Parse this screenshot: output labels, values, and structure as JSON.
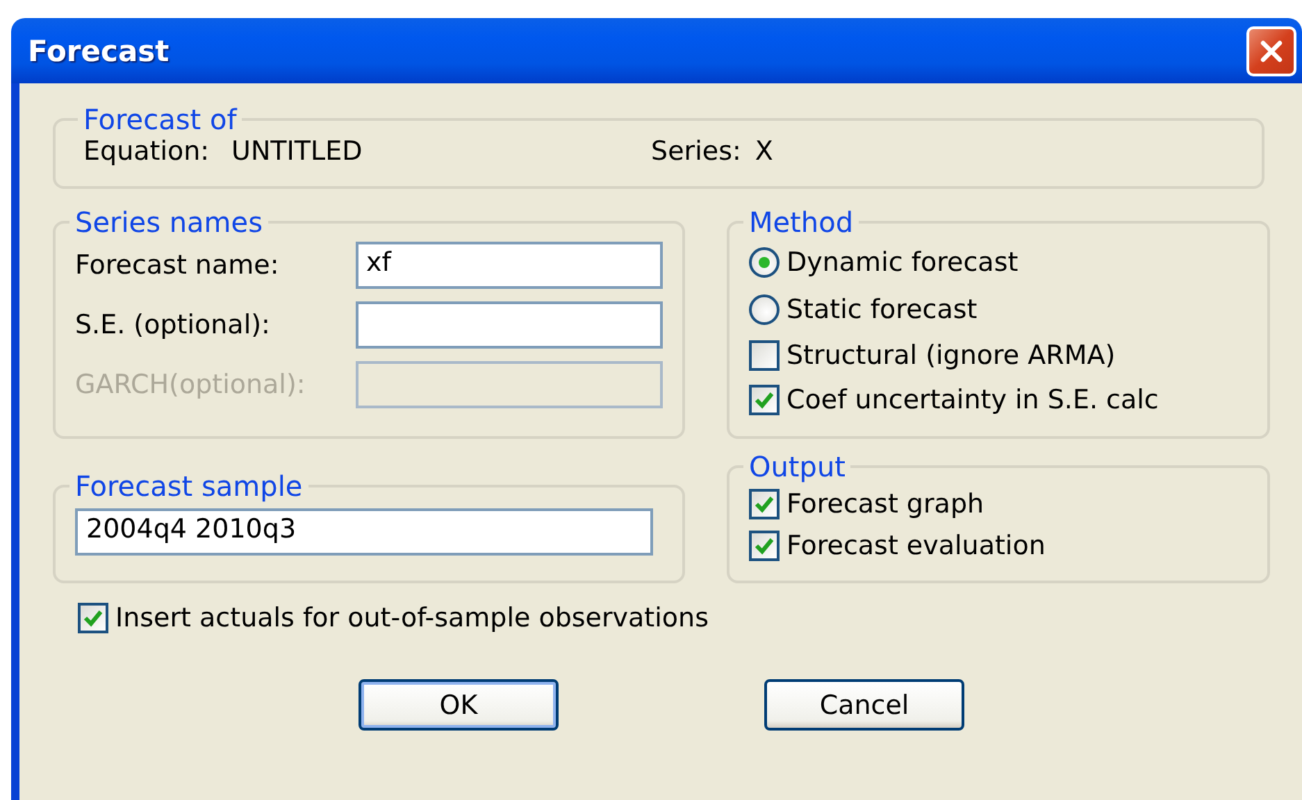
{
  "window": {
    "title": "Forecast"
  },
  "forecast_of": {
    "title": "Forecast of",
    "equation_label": "Equation:",
    "equation": "UNTITLED",
    "series_label": "Series:",
    "series": "X"
  },
  "series_names": {
    "title": "Series names",
    "fields": [
      {
        "label": "Forecast name:",
        "value": "xf",
        "disabled": false
      },
      {
        "label": "S.E. (optional):",
        "disabled": false
      },
      {
        "label": "GARCH(optional):",
        "disabled": true
      }
    ]
  },
  "method": {
    "title": "Method",
    "options": [
      {
        "kind": "radio",
        "label": "Dynamic forecast",
        "selected": true
      },
      {
        "kind": "radio",
        "label": "Static forecast",
        "selected": false
      },
      {
        "kind": "checkbox",
        "label": "Structural (ignore ARMA)",
        "checked": false
      },
      {
        "kind": "checkbox",
        "label": "Coef uncertainty in S.E. calc",
        "checked": true
      }
    ]
  },
  "forecast_sample": {
    "title": "Forecast sample",
    "value": "2004q4 2010q3"
  },
  "output": {
    "title": "Output",
    "options": [
      {
        "label": "Forecast graph",
        "checked": true
      },
      {
        "label": "Forecast evaluation",
        "checked": true
      }
    ]
  },
  "insert_actuals": {
    "label": "Insert actuals for out-of-sample observations",
    "checked": true
  },
  "buttons": [
    {
      "label": "OK",
      "default": true
    },
    {
      "label": "Cancel",
      "default": false
    }
  ]
}
